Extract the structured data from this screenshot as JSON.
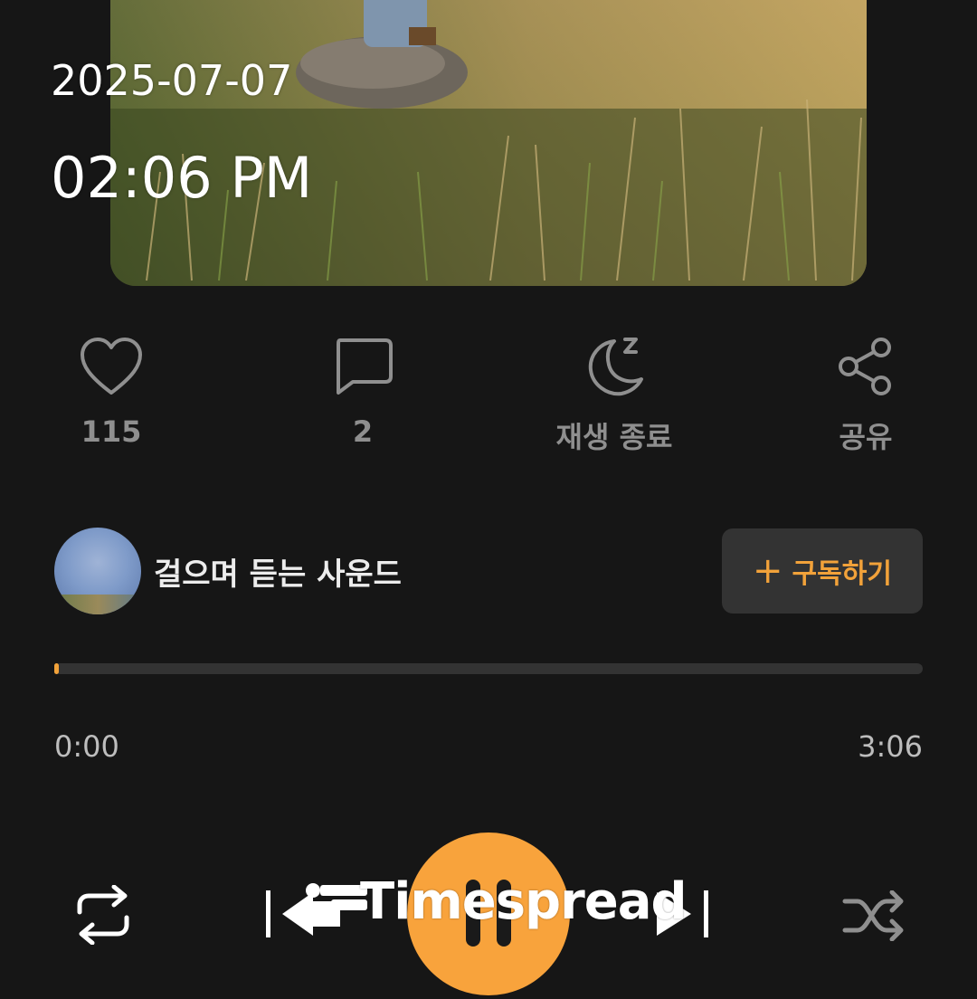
{
  "overlay": {
    "date": "2025-07-07",
    "time": "02:06 PM"
  },
  "actions": {
    "like_count": "115",
    "comment_count": "2",
    "sleep_timer_label": "재생 종료",
    "share_label": "공유"
  },
  "channel": {
    "name": "걸으며 듣는 사운드",
    "subscribe_label": "구독하기",
    "subscribe_icon": "plus-icon"
  },
  "playback": {
    "current_time": "0:00",
    "duration": "3:06",
    "progress_fraction": 0.004,
    "state": "playing"
  },
  "controls": {
    "repeat_icon": "repeat-icon",
    "previous_icon": "skip-previous-icon",
    "pause_icon": "pause-icon",
    "next_icon": "skip-next-icon",
    "shuffle_icon": "shuffle-icon"
  },
  "watermark": {
    "text": "Timespread"
  },
  "colors": {
    "background": "#161616",
    "accent": "#f8a33c",
    "icon_gray": "#8f8f8f",
    "button_bg": "#333333"
  }
}
